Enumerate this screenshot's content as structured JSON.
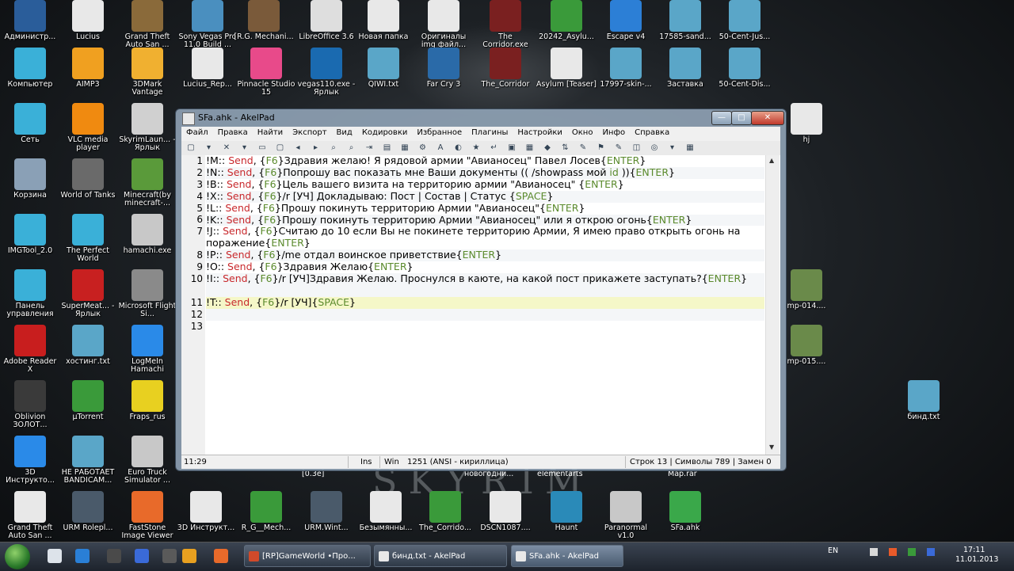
{
  "desktop": {
    "icons": [
      {
        "label": "Администр...",
        "color": "#2a5d9a"
      },
      {
        "label": "Lucius",
        "color": "#e8e8e8"
      },
      {
        "label": "Grand Theft Auto San ...",
        "color": "#8a6a3a"
      },
      {
        "label": "Sony Vegas Pro 11.0 Build ...",
        "color": "#4a8fbf"
      },
      {
        "label": "[R.G. Mechani...",
        "color": "#7a5a3a"
      },
      {
        "label": "LibreOffice 3.6",
        "color": "#dedede"
      },
      {
        "label": "Новая папка",
        "color": "#e8e8e8"
      },
      {
        "label": "Оригиналы img файл...",
        "color": "#e8e8e8"
      },
      {
        "label": "The Corridor.exe",
        "color": "#7a2020"
      },
      {
        "label": "20242_Asylu...",
        "color": "#3a9a3a"
      },
      {
        "label": "Escape v4",
        "color": "#2c7fd6"
      },
      {
        "label": "17585-sand...",
        "color": "#5aa6c8"
      },
      {
        "label": "50-Cent-Jus...",
        "color": "#5aa6c8"
      },
      {
        "label": "Компьютер",
        "color": "#3ab0d8"
      },
      {
        "label": "AIMP3",
        "color": "#f0a020"
      },
      {
        "label": "3DMark Vantage",
        "color": "#f0b030"
      },
      {
        "label": "Lucius_Rep...",
        "color": "#e8e8e8"
      },
      {
        "label": "Pinnacle Studio 15",
        "color": "#e84a8a"
      },
      {
        "label": "vegas110.exe - Ярлык",
        "color": "#1a6ab0"
      },
      {
        "label": "QIWI.txt",
        "color": "#5aa6c8"
      },
      {
        "label": "Far Cry 3",
        "color": "#2a6aa8"
      },
      {
        "label": "The_Corridor",
        "color": "#7a2020"
      },
      {
        "label": "Asylum [Teaser]",
        "color": "#e8e8e8"
      },
      {
        "label": "17997-skin-...",
        "color": "#5aa6c8"
      },
      {
        "label": "Заставка",
        "color": "#5aa6c8"
      },
      {
        "label": "50-Cent-Dis...",
        "color": "#5aa6c8"
      },
      {
        "label": "Сеть",
        "color": "#3ab0d8"
      },
      {
        "label": "VLC media player",
        "color": "#f08a10"
      },
      {
        "label": "SkyrimLaun... - Ярлык",
        "color": "#d0d0d0"
      },
      {
        "label": "hj",
        "color": "#e8e8e8"
      },
      {
        "label": "Корзина",
        "color": "#8aa0b6"
      },
      {
        "label": "World of Tanks",
        "color": "#6a6a6a"
      },
      {
        "label": "Minecraft(by minecraft-...",
        "color": "#5a9a3a"
      },
      {
        "label": "IMGTool_2.0",
        "color": "#3ab0d8"
      },
      {
        "label": "The Perfect World",
        "color": "#3ab0d8"
      },
      {
        "label": "hamachi.exe",
        "color": "#c8c8c8"
      },
      {
        "label": "Панель управления",
        "color": "#3ab0d8"
      },
      {
        "label": "SuperMeat... - Ярлык",
        "color": "#c82020"
      },
      {
        "label": "Microsoft Flight Si...",
        "color": "#8a8a8a"
      },
      {
        "label": "mp-014....",
        "color": "#6a8a4a"
      },
      {
        "label": "Adobe Reader X",
        "color": "#c81e1e"
      },
      {
        "label": "хостинг.txt",
        "color": "#5aa6c8"
      },
      {
        "label": "LogMeIn Hamachi",
        "color": "#2a8ae8"
      },
      {
        "label": "mp-015....",
        "color": "#6a8a4a"
      },
      {
        "label": "Oblivion ЗОЛОТ...",
        "color": "#3a3a3a"
      },
      {
        "label": "µTorrent",
        "color": "#3a9a3a"
      },
      {
        "label": "Fraps_rus",
        "color": "#e8d020"
      },
      {
        "label": "бинд.txt",
        "color": "#5aa6c8"
      },
      {
        "label": "3D Инструкто...",
        "color": "#2a8ae8"
      },
      {
        "label": "НЕ РАБОТАЕТ BANDICAM...",
        "color": "#5aa6c8"
      },
      {
        "label": "Euro Truck Simulator ...",
        "color": "#c8c8c8"
      },
      {
        "label": "Grand Theft Auto San ...",
        "color": "#e8e8e8"
      },
      {
        "label": "URM Rolepl...",
        "color": "#4a5a6a"
      },
      {
        "label": "FastStone Image Viewer",
        "color": "#e86a2a"
      },
      {
        "label": "3D Инструкт...",
        "color": "#e8e8e8"
      },
      {
        "label": "R_G__Mech...",
        "color": "#3a9a3a"
      },
      {
        "label": "URM.Wint...",
        "color": "#4a5a6a"
      },
      {
        "label": "Безымянны...",
        "color": "#e8e8e8"
      },
      {
        "label": "The_Corrido...",
        "color": "#3a9a3a"
      },
      {
        "label": "DSCN1087....",
        "color": "#e8e8e8"
      },
      {
        "label": "Haunt",
        "color": "#2a8ab8"
      },
      {
        "label": "Paranormal v1.0",
        "color": "#c8c8c8"
      },
      {
        "label": "SFa.ahk",
        "color": "#3aa84a"
      }
    ],
    "partial_labels": [
      "[0.3e]",
      "новогодни...",
      "elementarts",
      "Map.rar"
    ],
    "wallpaper_text": "SKYRIM"
  },
  "window": {
    "title": "SFa.ahk - AkelPad",
    "menu": [
      "Файл",
      "Правка",
      "Найти",
      "Экспорт",
      "Вид",
      "Кодировки",
      "Избранное",
      "Плагины",
      "Настройки",
      "Окно",
      "Инфо",
      "Справка"
    ],
    "controls": {
      "minimize": "—",
      "maximize": "□",
      "close": "✕"
    },
    "lines": [
      {
        "n": "1",
        "segs": [
          [
            "!M:: ",
            ""
          ],
          [
            "Send",
            ""
          ],
          [
            ", {",
            ""
          ],
          [
            "F6",
            "key"
          ],
          [
            "}Здравия желаю!   Я рядовой армии \"Авианосец\" Павел Лосев{",
            ""
          ],
          [
            "ENTER",
            "key"
          ],
          [
            "}",
            ""
          ]
        ]
      },
      {
        "n": "2",
        "segs": [
          [
            "!N:: ",
            ""
          ],
          [
            "Send",
            ""
          ],
          [
            ", {",
            ""
          ],
          [
            "F6",
            "key"
          ],
          [
            "}Попрошу вас показать мне Ваши документы (( /showpass мой ",
            ""
          ],
          [
            "id",
            "key"
          ],
          [
            " )){",
            ""
          ],
          [
            "ENTER",
            "key"
          ],
          [
            "}",
            ""
          ]
        ]
      },
      {
        "n": "3",
        "segs": [
          [
            "!B:: ",
            ""
          ],
          [
            "Send",
            ""
          ],
          [
            ", {",
            ""
          ],
          [
            "F6",
            "key"
          ],
          [
            "}Цель вашего визита на территорию армии \"Авианосец\" {",
            ""
          ],
          [
            "ENTER",
            "key"
          ],
          [
            "}",
            ""
          ]
        ]
      },
      {
        "n": "4",
        "segs": [
          [
            "!X:: ",
            ""
          ],
          [
            "Send",
            ""
          ],
          [
            ", {",
            ""
          ],
          [
            "F6",
            "key"
          ],
          [
            "}/r [УЧ] Докладываю: Пост  | Состав  | Статус {",
            ""
          ],
          [
            "SPACE",
            "key"
          ],
          [
            "}",
            ""
          ]
        ]
      },
      {
        "n": "5",
        "segs": [
          [
            "!L:: ",
            ""
          ],
          [
            "Send",
            ""
          ],
          [
            ", {",
            ""
          ],
          [
            "F6",
            "key"
          ],
          [
            "}Прошу покинуть территорию Армии \"Авианосец\"{",
            ""
          ],
          [
            "ENTER",
            "key"
          ],
          [
            "}",
            ""
          ]
        ]
      },
      {
        "n": "6",
        "segs": [
          [
            "!K:: ",
            ""
          ],
          [
            "Send",
            ""
          ],
          [
            ", {",
            ""
          ],
          [
            "F6",
            "key"
          ],
          [
            "}Прошу покинуть территорию Армии \"Авианосец\" или я открою огонь{",
            ""
          ],
          [
            "ENTER",
            "key"
          ],
          [
            "}",
            ""
          ]
        ]
      },
      {
        "n": "7",
        "wrap": true,
        "segs": [
          [
            "!J:: ",
            ""
          ],
          [
            "Send",
            ""
          ],
          [
            ", {",
            ""
          ],
          [
            "F6",
            "key"
          ],
          [
            "}Считаю до 10 если Вы не покинете территорию Армии, Я имею право открыть огонь на поражение{",
            ""
          ],
          [
            "ENTER",
            "key"
          ],
          [
            "}",
            ""
          ]
        ]
      },
      {
        "n": "8",
        "segs": [
          [
            "!P:: ",
            ""
          ],
          [
            "Send",
            ""
          ],
          [
            ", {",
            ""
          ],
          [
            "F6",
            "key"
          ],
          [
            "}/me отдал воинское приветствие{",
            ""
          ],
          [
            "ENTER",
            "key"
          ],
          [
            "}",
            ""
          ]
        ]
      },
      {
        "n": "9",
        "segs": [
          [
            "!O:: ",
            ""
          ],
          [
            "Send",
            ""
          ],
          [
            ", {",
            ""
          ],
          [
            "F6",
            "key"
          ],
          [
            "}Здравия Желаю{",
            ""
          ],
          [
            "ENTER",
            "key"
          ],
          [
            "}",
            ""
          ]
        ]
      },
      {
        "n": "10",
        "wrap": true,
        "segs": [
          [
            "!I:: ",
            ""
          ],
          [
            "Send",
            ""
          ],
          [
            ", {",
            ""
          ],
          [
            "F6",
            "key"
          ],
          [
            "}/r [УЧ]Здравия Желаю.  Проснулся в каюте, на какой пост прикажете заступать?{",
            ""
          ],
          [
            "ENTER",
            "key"
          ],
          [
            "}",
            ""
          ]
        ]
      },
      {
        "n": "11",
        "cur": true,
        "segs": [
          [
            "!T:: ",
            ""
          ],
          [
            "Send",
            ""
          ],
          [
            ", {",
            ""
          ],
          [
            "F6",
            "key"
          ],
          [
            "}/r [УЧ]{",
            ""
          ],
          [
            "SPACE",
            "key"
          ],
          [
            "}",
            ""
          ]
        ]
      },
      {
        "n": "12",
        "segs": []
      },
      {
        "n": "13",
        "segs": []
      }
    ],
    "status": {
      "pos": "11:29",
      "ins": "Ins",
      "eol": "Win",
      "codepage": "1251  (ANSI - кириллица)",
      "line": "Строк 13 | Символы 789 | Замен 0"
    }
  },
  "taskbar": {
    "tasks": [
      {
        "label": "[RP]GameWorld •Про...",
        "color": "#d04a2a"
      },
      {
        "label": "бинд.txt - AkelPad",
        "color": "#e8e8e8"
      },
      {
        "label": "SFa.ahk - AkelPad",
        "color": "#e8e8e8"
      }
    ],
    "lang": "EN",
    "time": "17:11",
    "date": "11.01.2013"
  },
  "colors": {
    "cmd": "#c8282c",
    "key": "#5a8a2c",
    "current_line": "#f5f7c8"
  }
}
